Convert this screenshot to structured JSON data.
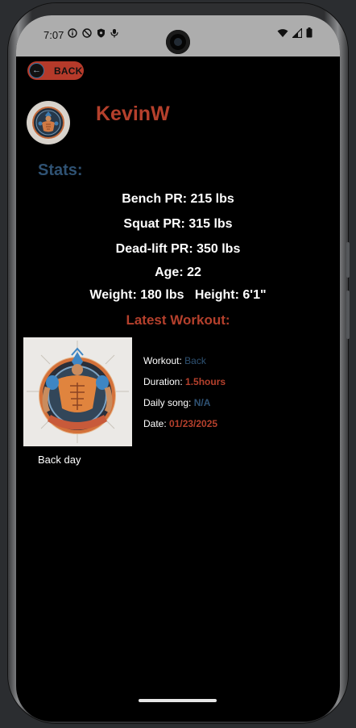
{
  "status_bar": {
    "time": "7:07",
    "left_icons": [
      "info-icon",
      "do-not-disturb-icon",
      "shield-icon",
      "usb-debug-icon"
    ],
    "right_icons": [
      "wifi-icon",
      "signal-icon",
      "battery-icon"
    ]
  },
  "header": {
    "back_label": "BACK"
  },
  "profile": {
    "username": "KevinW"
  },
  "stats": {
    "title": "Stats:",
    "bench": "Bench PR: 215 lbs",
    "squat": "Squat PR: 315 lbs",
    "deadlift": "Dead-lift PR: 350 lbs",
    "age": "Age: 22",
    "weight_height": "Weight: 180 lbs   Height: 6'1\""
  },
  "latest_workout": {
    "title": "Latest Workout:",
    "caption": "Back day",
    "workout_label": "Workout: ",
    "workout_value": "Back",
    "duration_label": "Duration: ",
    "duration_value": "1.5hours",
    "song_label": "Daily song: ",
    "song_value": "N/A",
    "date_label": "Date: ",
    "date_value": "01/23/2025"
  },
  "colors": {
    "accent_red": "#b5402c",
    "accent_blue": "#2f5273",
    "background": "#000000"
  }
}
